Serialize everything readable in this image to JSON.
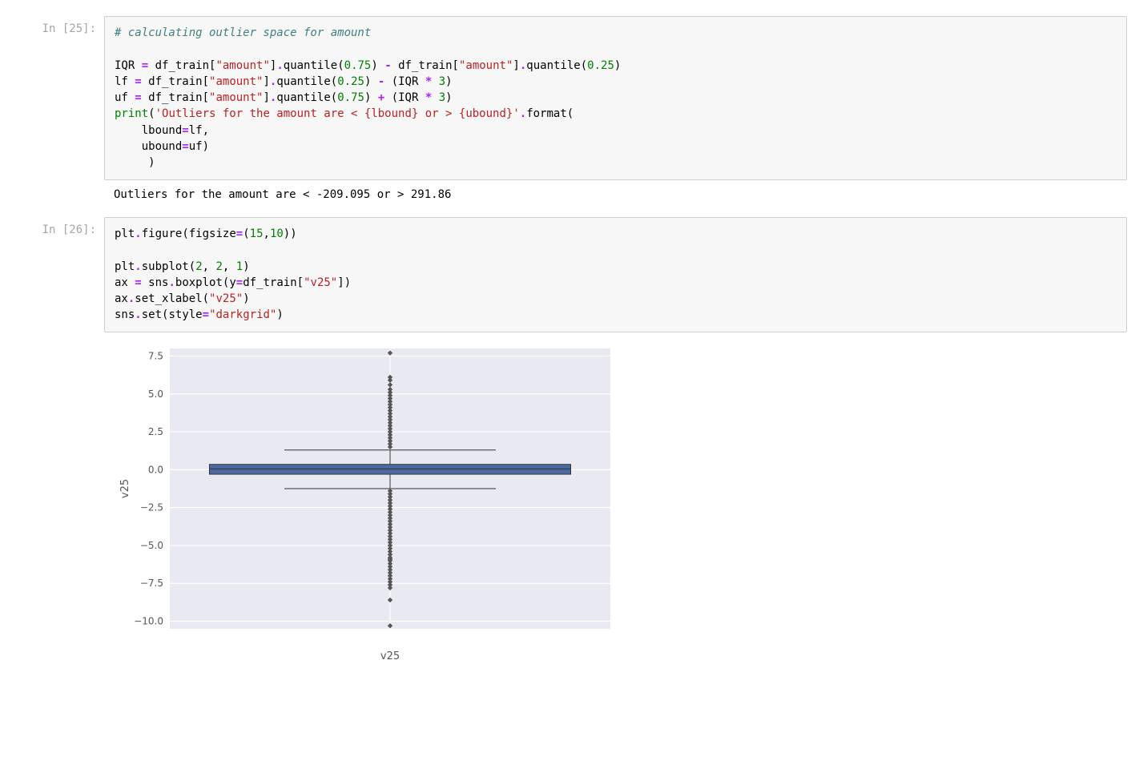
{
  "cell25": {
    "prompt": "In [25]:",
    "code_tokens": [
      [
        "cm",
        "# calculating outlier space for amount"
      ],
      [
        "nl"
      ],
      [
        "nl"
      ],
      [
        "nm",
        "IQR "
      ],
      [
        "op",
        "="
      ],
      [
        "nm",
        " df_train"
      ],
      [
        "pn",
        "["
      ],
      [
        "st",
        "\"amount\""
      ],
      [
        "pn",
        "]"
      ],
      [
        "op",
        "."
      ],
      [
        "nm",
        "quantile"
      ],
      [
        "pn",
        "("
      ],
      [
        "nb",
        "0.75"
      ],
      [
        "pn",
        ")"
      ],
      [
        "nm",
        " "
      ],
      [
        "op",
        "-"
      ],
      [
        "nm",
        " df_train"
      ],
      [
        "pn",
        "["
      ],
      [
        "st",
        "\"amount\""
      ],
      [
        "pn",
        "]"
      ],
      [
        "op",
        "."
      ],
      [
        "nm",
        "quantile"
      ],
      [
        "pn",
        "("
      ],
      [
        "nb",
        "0.25"
      ],
      [
        "pn",
        ")"
      ],
      [
        "nl"
      ],
      [
        "nm",
        "lf "
      ],
      [
        "op",
        "="
      ],
      [
        "nm",
        " df_train"
      ],
      [
        "pn",
        "["
      ],
      [
        "st",
        "\"amount\""
      ],
      [
        "pn",
        "]"
      ],
      [
        "op",
        "."
      ],
      [
        "nm",
        "quantile"
      ],
      [
        "pn",
        "("
      ],
      [
        "nb",
        "0.25"
      ],
      [
        "pn",
        ")"
      ],
      [
        "nm",
        " "
      ],
      [
        "op",
        "-"
      ],
      [
        "nm",
        " "
      ],
      [
        "pn",
        "("
      ],
      [
        "nm",
        "IQR "
      ],
      [
        "op",
        "*"
      ],
      [
        "nm",
        " "
      ],
      [
        "nb",
        "3"
      ],
      [
        "pn",
        ")"
      ],
      [
        "nl"
      ],
      [
        "nm",
        "uf "
      ],
      [
        "op",
        "="
      ],
      [
        "nm",
        " df_train"
      ],
      [
        "pn",
        "["
      ],
      [
        "st",
        "\"amount\""
      ],
      [
        "pn",
        "]"
      ],
      [
        "op",
        "."
      ],
      [
        "nm",
        "quantile"
      ],
      [
        "pn",
        "("
      ],
      [
        "nb",
        "0.75"
      ],
      [
        "pn",
        ")"
      ],
      [
        "nm",
        " "
      ],
      [
        "op",
        "+"
      ],
      [
        "nm",
        " "
      ],
      [
        "pn",
        "("
      ],
      [
        "nm",
        "IQR "
      ],
      [
        "op",
        "*"
      ],
      [
        "nm",
        " "
      ],
      [
        "nb",
        "3"
      ],
      [
        "pn",
        ")"
      ],
      [
        "nl"
      ],
      [
        "bt",
        "print"
      ],
      [
        "pn",
        "("
      ],
      [
        "st",
        "'Outliers for the amount are < {lbound} or > {ubound}'"
      ],
      [
        "op",
        "."
      ],
      [
        "nm",
        "format"
      ],
      [
        "pn",
        "("
      ],
      [
        "nl"
      ],
      [
        "nm",
        "    lbound"
      ],
      [
        "op",
        "="
      ],
      [
        "nm",
        "lf"
      ],
      [
        "pn",
        ","
      ],
      [
        "nl"
      ],
      [
        "nm",
        "    ubound"
      ],
      [
        "op",
        "="
      ],
      [
        "nm",
        "uf"
      ],
      [
        "pn",
        ")"
      ],
      [
        "nl"
      ],
      [
        "nm",
        "     "
      ],
      [
        "pn",
        ")"
      ]
    ],
    "output": "Outliers for the amount are < -209.095 or > 291.86"
  },
  "cell26": {
    "prompt": "In [26]:",
    "code_tokens": [
      [
        "nm",
        "plt"
      ],
      [
        "op",
        "."
      ],
      [
        "nm",
        "figure"
      ],
      [
        "pn",
        "("
      ],
      [
        "nm",
        "figsize"
      ],
      [
        "op",
        "="
      ],
      [
        "pn",
        "("
      ],
      [
        "nb",
        "15"
      ],
      [
        "pn",
        ","
      ],
      [
        "nb",
        "10"
      ],
      [
        "pn",
        ")"
      ],
      [
        "pn",
        ")"
      ],
      [
        "nl"
      ],
      [
        "nl"
      ],
      [
        "nm",
        "plt"
      ],
      [
        "op",
        "."
      ],
      [
        "nm",
        "subplot"
      ],
      [
        "pn",
        "("
      ],
      [
        "nb",
        "2"
      ],
      [
        "pn",
        ", "
      ],
      [
        "nb",
        "2"
      ],
      [
        "pn",
        ", "
      ],
      [
        "nb",
        "1"
      ],
      [
        "pn",
        ")"
      ],
      [
        "nl"
      ],
      [
        "nm",
        "ax "
      ],
      [
        "op",
        "="
      ],
      [
        "nm",
        " sns"
      ],
      [
        "op",
        "."
      ],
      [
        "nm",
        "boxplot"
      ],
      [
        "pn",
        "("
      ],
      [
        "nm",
        "y"
      ],
      [
        "op",
        "="
      ],
      [
        "nm",
        "df_train"
      ],
      [
        "pn",
        "["
      ],
      [
        "st",
        "\"v25\""
      ],
      [
        "pn",
        "]"
      ],
      [
        "pn",
        ")"
      ],
      [
        "nl"
      ],
      [
        "nm",
        "ax"
      ],
      [
        "op",
        "."
      ],
      [
        "nm",
        "set_xlabel"
      ],
      [
        "pn",
        "("
      ],
      [
        "st",
        "\"v25\""
      ],
      [
        "pn",
        ")"
      ],
      [
        "nl"
      ],
      [
        "nm",
        "sns"
      ],
      [
        "op",
        "."
      ],
      [
        "nm",
        "set"
      ],
      [
        "pn",
        "("
      ],
      [
        "nm",
        "style"
      ],
      [
        "op",
        "="
      ],
      [
        "st",
        "\"darkgrid\""
      ],
      [
        "pn",
        ")"
      ]
    ]
  },
  "chart_data": {
    "type": "boxplot",
    "xlabel": "v25",
    "ylabel": "v25",
    "x_categories": [
      "v25"
    ],
    "ylim": [
      -10.5,
      8.0
    ],
    "yticks": [
      -10.0,
      -7.5,
      -5.0,
      -2.5,
      0.0,
      2.5,
      5.0,
      7.5
    ],
    "ytick_labels": [
      "−10.0",
      "−7.5",
      "−5.0",
      "−2.5",
      "0.0",
      "2.5",
      "5.0",
      "7.5"
    ],
    "box": {
      "q1": -0.3,
      "median": 0.05,
      "q3": 0.35,
      "whisker_low": -1.25,
      "whisker_high": 1.3
    },
    "outliers": [
      -10.3,
      -8.6,
      -7.8,
      -7.6,
      -7.4,
      -7.2,
      -7.0,
      -6.8,
      -6.6,
      -6.4,
      -6.2,
      -6.0,
      -5.9,
      -5.8,
      -5.6,
      -5.4,
      -5.2,
      -5.0,
      -4.8,
      -4.6,
      -4.4,
      -4.2,
      -4.0,
      -3.8,
      -3.6,
      -3.4,
      -3.2,
      -3.0,
      -2.8,
      -2.6,
      -2.4,
      -2.2,
      -2.0,
      -1.8,
      -1.6,
      -1.4,
      1.5,
      1.7,
      1.9,
      2.1,
      2.3,
      2.5,
      2.7,
      2.9,
      3.1,
      3.3,
      3.5,
      3.7,
      3.9,
      4.1,
      4.3,
      4.5,
      4.7,
      4.9,
      5.1,
      5.3,
      5.6,
      5.9,
      6.1,
      7.7
    ]
  }
}
